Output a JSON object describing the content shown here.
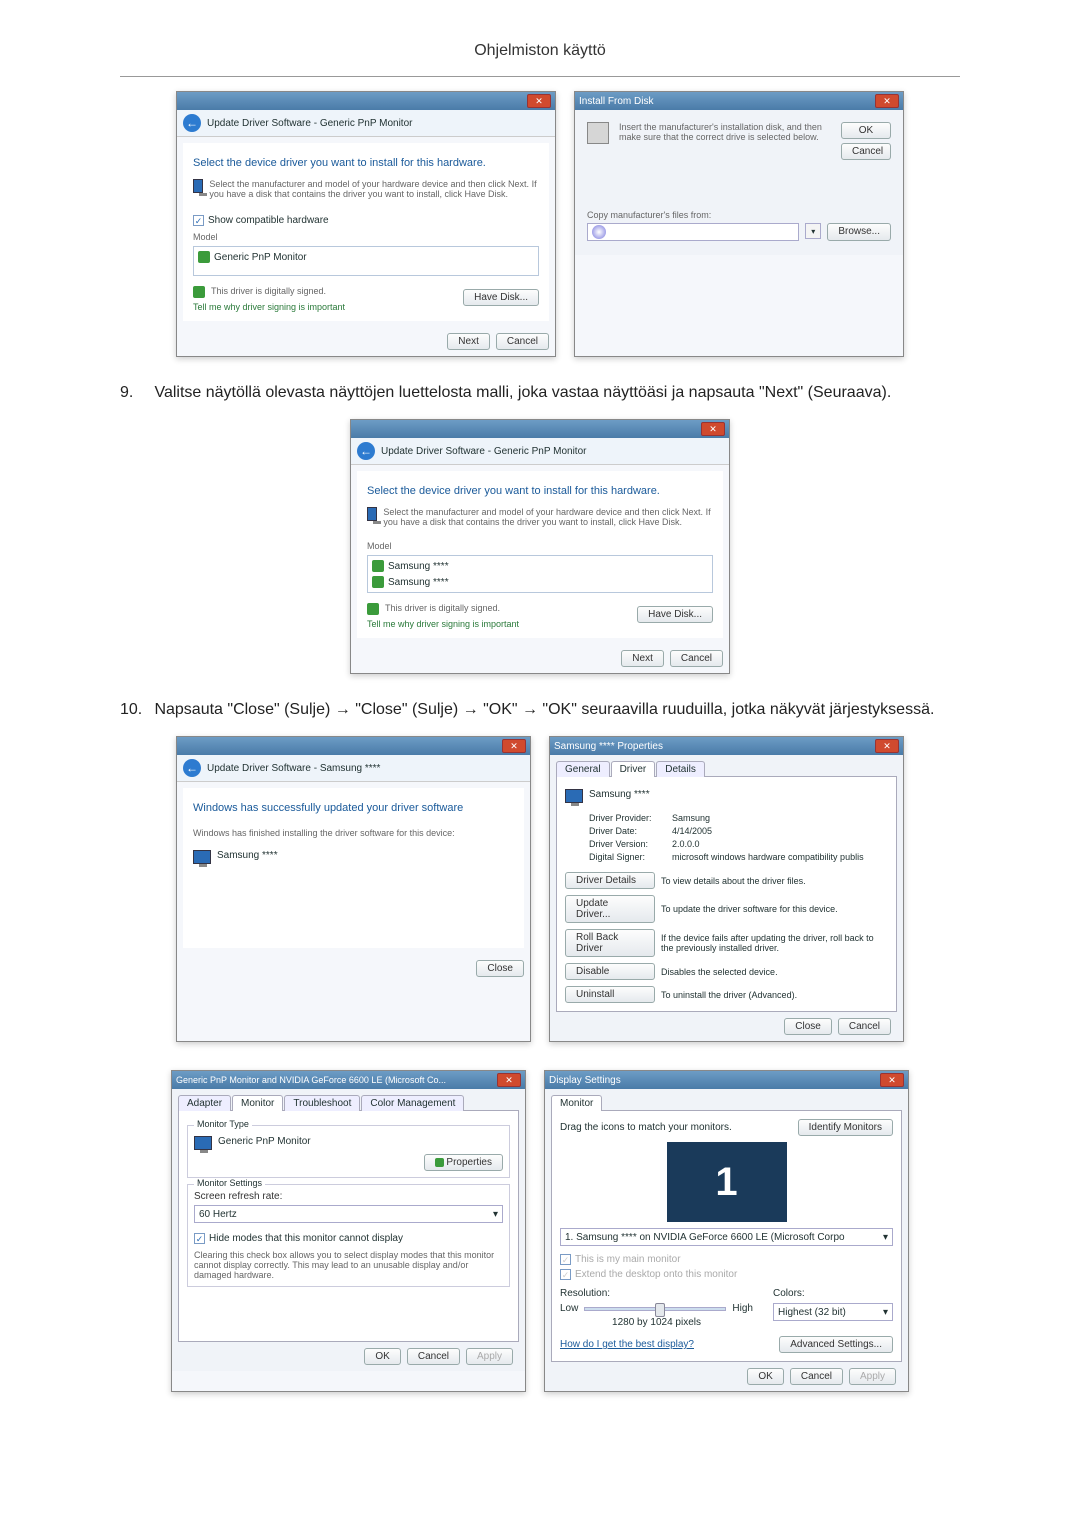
{
  "page": {
    "header": "Ohjelmiston käyttö",
    "step9_num": "9.",
    "step9_text": "Valitse näytöllä olevasta näyttöjen luettelosta malli, joka vastaa näyttöäsi ja napsauta \"Next\" (Seuraava).",
    "step10_num": "10.",
    "step10_text": "Napsauta \"Close\" (Sulje) → \"Close\" (Sulje) → \"OK\" → \"OK\" seuraavilla ruuduilla, jotka näkyvät järjestyksessä."
  },
  "dlg1": {
    "breadcrumb": "Update Driver Software - Generic PnP Monitor",
    "instruction": "Select the device driver you want to install for this hardware.",
    "hint": "Select the manufacturer and model of your hardware device and then click Next. If you have a disk that contains the driver you want to install, click Have Disk.",
    "show_compat": "Show compatible hardware",
    "model": "Model",
    "item": "Generic PnP Monitor",
    "signed": "This driver is digitally signed.",
    "tell": "Tell me why driver signing is important",
    "have_disk": "Have Disk...",
    "next": "Next",
    "cancel": "Cancel"
  },
  "dlg2": {
    "title": "Install From Disk",
    "instruction": "Insert the manufacturer's installation disk, and then make sure that the correct drive is selected below.",
    "ok": "OK",
    "cancel": "Cancel",
    "copy_from": "Copy manufacturer's files from:",
    "browse": "Browse..."
  },
  "dlg3": {
    "breadcrumb": "Update Driver Software - Generic PnP Monitor",
    "instruction": "Select the device driver you want to install for this hardware.",
    "hint": "Select the manufacturer and model of your hardware device and then click Next. If you have a disk that contains the driver you want to install, click Have Disk.",
    "model": "Model",
    "item1": "Samsung ****",
    "item2": "Samsung ****",
    "signed": "This driver is digitally signed.",
    "tell": "Tell me why driver signing is important",
    "have_disk": "Have Disk...",
    "next": "Next",
    "cancel": "Cancel"
  },
  "dlg4": {
    "breadcrumb": "Update Driver Software - Samsung ****",
    "heading": "Windows has successfully updated your driver software",
    "sub": "Windows has finished installing the driver software for this device:",
    "device": "Samsung ****",
    "close": "Close"
  },
  "dlg5": {
    "title": "Samsung **** Properties",
    "tabs": {
      "general": "General",
      "driver": "Driver",
      "details": "Details"
    },
    "device": "Samsung ****",
    "rows": {
      "provider_l": "Driver Provider:",
      "provider_v": "Samsung",
      "date_l": "Driver Date:",
      "date_v": "4/14/2005",
      "version_l": "Driver Version:",
      "version_v": "2.0.0.0",
      "signer_l": "Digital Signer:",
      "signer_v": "microsoft windows hardware compatibility publis"
    },
    "btns": {
      "details": "Driver Details",
      "details_d": "To view details about the driver files.",
      "update": "Update Driver...",
      "update_d": "To update the driver software for this device.",
      "rollback": "Roll Back Driver",
      "rollback_d": "If the device fails after updating the driver, roll back to the previously installed driver.",
      "disable": "Disable",
      "disable_d": "Disables the selected device.",
      "uninstall": "Uninstall",
      "uninstall_d": "To uninstall the driver (Advanced)."
    },
    "close": "Close",
    "cancel": "Cancel"
  },
  "dlg6": {
    "title": "Generic PnP Monitor and NVIDIA GeForce 6600 LE (Microsoft Co...",
    "tabs": {
      "adapter": "Adapter",
      "monitor": "Monitor",
      "trouble": "Troubleshoot",
      "color": "Color Management"
    },
    "type_group": "Monitor Type",
    "type": "Generic PnP Monitor",
    "properties": "Properties",
    "settings_group": "Monitor Settings",
    "refresh": "Screen refresh rate:",
    "refresh_v": "60 Hertz",
    "hide": "Hide modes that this monitor cannot display",
    "hide_desc": "Clearing this check box allows you to select display modes that this monitor cannot display correctly. This may lead to an unusable display and/or damaged hardware.",
    "ok": "OK",
    "cancel": "Cancel",
    "apply": "Apply"
  },
  "dlg7": {
    "title": "Display Settings",
    "tab": "Monitor",
    "drag": "Drag the icons to match your monitors.",
    "identify": "Identify Monitors",
    "preview": "1",
    "select": "1. Samsung **** on NVIDIA GeForce 6600 LE (Microsoft Corpo",
    "main": "This is my main monitor",
    "extend": "Extend the desktop onto this monitor",
    "res_l": "Resolution:",
    "low": "Low",
    "high": "High",
    "res_v": "1280 by 1024 pixels",
    "colors_l": "Colors:",
    "colors_v": "Highest (32 bit)",
    "best": "How do I get the best display?",
    "adv": "Advanced Settings...",
    "ok": "OK",
    "cancel": "Cancel",
    "apply": "Apply"
  }
}
